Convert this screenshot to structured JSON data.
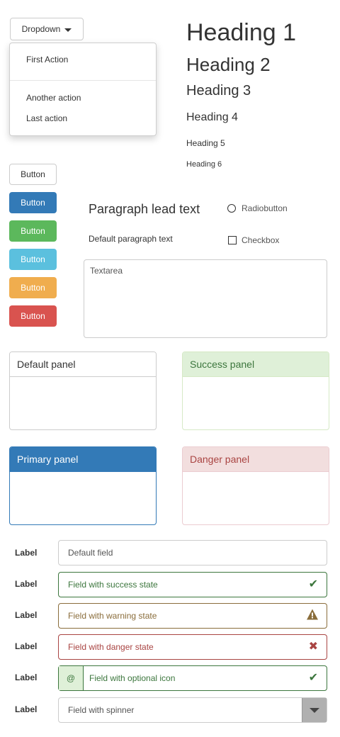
{
  "dropdown": {
    "toggle_label": "Dropdown",
    "items": [
      "First Action",
      "Another action",
      "Last action"
    ]
  },
  "headings": [
    "Heading 1",
    "Heading 2",
    "Heading 3",
    "Heading 4",
    "Heading 5",
    "Heading 6"
  ],
  "buttons": [
    "Button",
    "Button",
    "Button",
    "Button",
    "Button",
    "Button"
  ],
  "text": {
    "lead": "Paragraph lead text",
    "paragraph": "Default paragraph text"
  },
  "radio": {
    "label": "Radiobutton",
    "checked": false
  },
  "checkbox": {
    "label": "Checkbox",
    "checked": false
  },
  "textarea": {
    "placeholder": "Textarea"
  },
  "panels": {
    "default": "Default panel",
    "success": "Success panel",
    "primary": "Primary panel",
    "danger": "Danger panel"
  },
  "form": {
    "label": "Label",
    "fields": {
      "default": "Default field",
      "success": "Field with success state",
      "warning": "Field with warning state",
      "danger": "Field with danger state",
      "optional": "Field with optional icon",
      "spinner": "Field with spinner"
    },
    "addon": "@",
    "icons": {
      "success": "checkmark-icon",
      "warning": "warning-icon",
      "danger": "cross-icon",
      "optional": "checkmark-icon",
      "spinner": "chevron-down-icon"
    }
  },
  "colors": {
    "primary": "#337ab7",
    "success": "#5cb85c",
    "info": "#5bc0de",
    "warning": "#f0ad4e",
    "danger": "#d9534f"
  }
}
